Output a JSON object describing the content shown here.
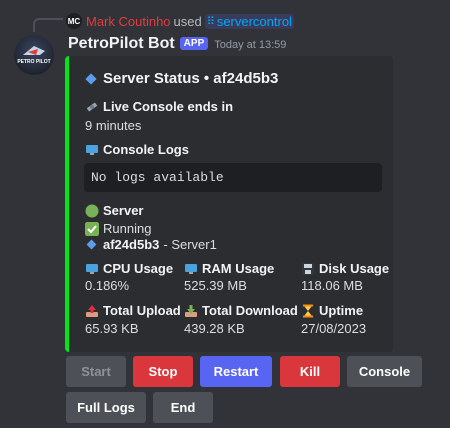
{
  "reply": {
    "avatar_text": "MC",
    "user": "Mark Coutinho",
    "used": "used",
    "command": "servercontrol"
  },
  "message": {
    "avatar_text": "PETRO PILOT",
    "bot_name": "PetroPilot Bot",
    "app_tag": "APP",
    "timestamp": "Today at 13:59"
  },
  "embed": {
    "accent_color": "#00e61a",
    "title": "Server Status • af24d5b3",
    "live_console_label": "Live Console ends in",
    "live_console_value": "9 minutes",
    "console_logs_label": "Console Logs",
    "console_logs_value": "No logs available",
    "server_label": "Server",
    "server_status": "Running",
    "server_id": "af24d5b3",
    "server_name": "- Server1",
    "stats": [
      {
        "label": "CPU Usage",
        "value": "0.186%",
        "icon": "monitor-icon"
      },
      {
        "label": "RAM Usage",
        "value": "525.39 MB",
        "icon": "monitor-icon"
      },
      {
        "label": "Disk Usage",
        "value": "118.06 MB",
        "icon": "floppy-disk-icon"
      },
      {
        "label": "Total Upload",
        "value": "65.93 KB",
        "icon": "upload-tray-icon"
      },
      {
        "label": "Total Download",
        "value": "439.28 KB",
        "icon": "download-tray-icon"
      },
      {
        "label": "Uptime",
        "value": "27/08/2023",
        "icon": "hourglass-icon"
      }
    ]
  },
  "buttons": {
    "start": "Start",
    "stop": "Stop",
    "restart": "Restart",
    "kill": "Kill",
    "console": "Console",
    "full_logs": "Full Logs",
    "end": "End"
  },
  "colors": {
    "background": "#313338",
    "embed_bg": "#2b2d31",
    "danger": "#da373c",
    "primary": "#5865f2",
    "secondary": "#4e5058"
  }
}
